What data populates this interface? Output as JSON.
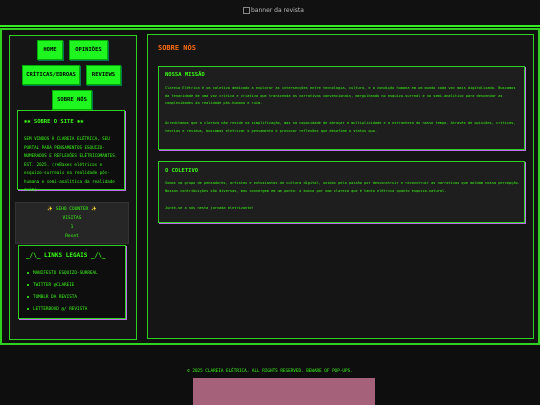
{
  "header": {
    "banner_alt": "banner da revista"
  },
  "nav": {
    "home": "HOME",
    "opinioes": "OPINIÕES",
    "criticas": "CRÍTICAS/EDROAS",
    "reviews": "REVIEWS",
    "sobre_nos": "SOBRE NÓS"
  },
  "sobre_site": {
    "title": "✱✱ SOBRE O SITE ✱✱",
    "text": "SEM VINDOS À CLAREIA ELÉTRICA, SEU PORTAL PARA PENSAMENTOS ESQUIZO-NUMERADOS E REFLEXÕES ELÉTRICOMANTES. EST. 2025. ⟨reBaxes elétricos e esquizo-surreais na realidade pós-humana e semi-analítica da realidade ruim⟩"
  },
  "counter": {
    "title": "✨ SEHO COUNTER ✨",
    "label": "VISITAS",
    "count": "1",
    "reset": "Reset"
  },
  "links": {
    "title": "_/\\_ LINKS LEGAIS _/\\_",
    "items": [
      "MANIFESTO ESQUIZO-SURREAL",
      "TWITTER @CLAREIE",
      "TUMBLR DA REVISTA",
      "LETTERBOXD @/ REVISTA"
    ]
  },
  "main": {
    "title": "SOBRE NÓS",
    "missao": {
      "title": "NOSSA MISSÃO",
      "p1": "Clareia Elétrica é um coletivo dedicado a explorar as intersecções entre tecnologia, cultura, e a condição humana em um mundo cada vez mais digitalizado. Buscamos da tenacidade de uma voz crítica e criativa que transcenda as narrativas convencionais, mergulhando no esquizo-surreal e no semi-analítico para desvendar as complexidades da realidade pós-humana e ruim.",
      "p2": "Acreditamos que a clareza não reside na simplificação, mas na capacidade de abraçar a multiplicidade e a estranheza do nosso tempo. Através de opiniões, críticas, teorias e reviews, buscamos eletrizar o pensamento e provocar reflexões que desafiem o status quo."
    },
    "coletivo": {
      "title": "O COLETIVO",
      "p1": "Somos um grupo de pensadores, artistas e entusiastas da cultura digital, unidos pela paixão por desconstruir e reconstruir as narrativas que moldam nossa percepção. Nossas contribuições são diversas, mas convergem em um ponto: a busca por uma clareza que é tanto elétrica quanto esquizo-natural.",
      "p2": "Junte-se a nós nesta jornada eletrizante!"
    }
  },
  "footer": {
    "text": "© 2025 CLAREIA ELÉTRICA. ALL RIGHTS RESERVED. BEWARE OF POP-UPS."
  },
  "colors": {
    "accent": "#39ff14",
    "title_orange": "#ff6a10",
    "shadow_purple": "#c06cf0",
    "footer_block": "#a5617a"
  }
}
